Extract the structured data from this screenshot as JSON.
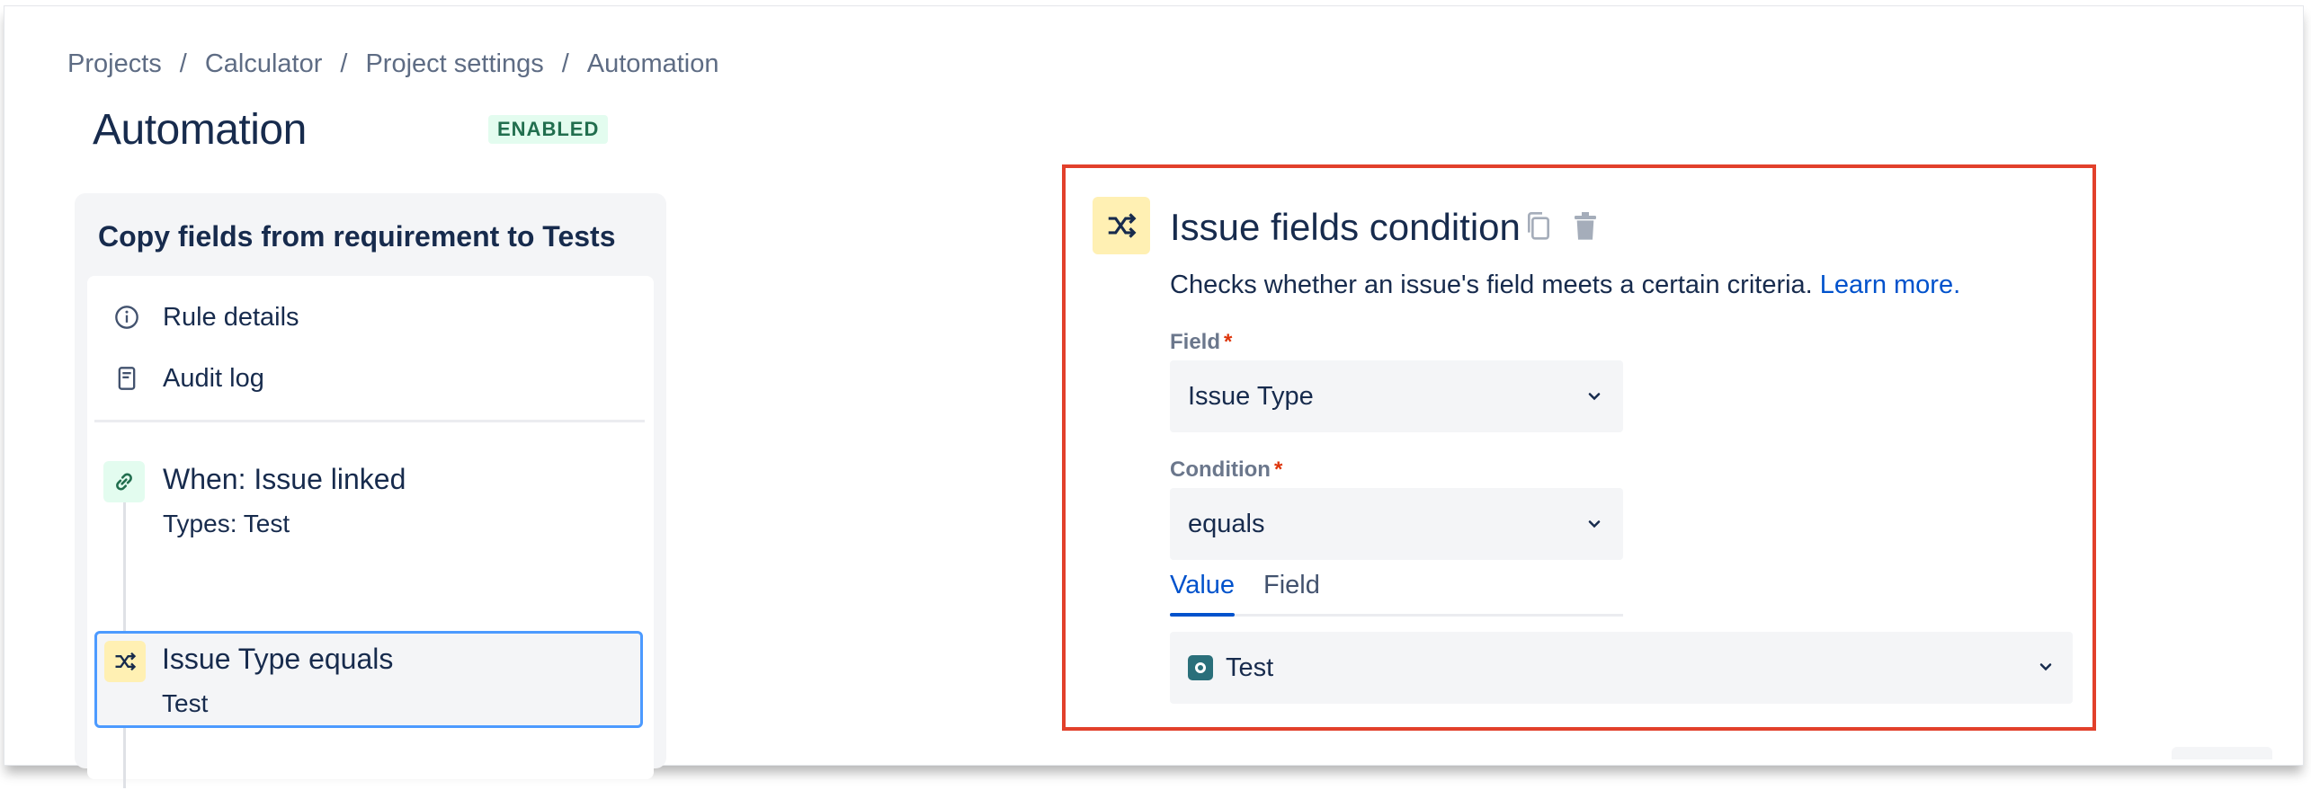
{
  "breadcrumb": {
    "items": [
      "Projects",
      "Calculator",
      "Project settings",
      "Automation"
    ],
    "separator": "/"
  },
  "page": {
    "title": "Automation",
    "status": "ENABLED"
  },
  "rule": {
    "name": "Copy fields from requirement to Tests",
    "menu": [
      {
        "label": "Rule details",
        "icon": "info-icon"
      },
      {
        "label": "Audit log",
        "icon": "document-icon"
      }
    ],
    "trigger": {
      "title": "When: Issue linked",
      "subtitle": "Types: Test",
      "icon": "link-icon"
    },
    "condition": {
      "title": "Issue Type equals",
      "subtitle": "Test",
      "icon": "shuffle-icon"
    }
  },
  "config": {
    "title": "Issue fields condition",
    "description": "Checks whether an issue's field meets a certain criteria.",
    "learn_more": "Learn more.",
    "field_label": "Field",
    "field_value": "Issue Type",
    "condition_label": "Condition",
    "condition_value": "equals",
    "tabs": [
      "Value",
      "Field"
    ],
    "value": "Test",
    "required_marker": "*"
  },
  "colors": {
    "accent": "#0052cc",
    "highlight_border": "#e2402b",
    "selected_border": "#4c9aff",
    "condition_bg": "#fff0b3",
    "trigger_bg": "#e3fcef",
    "enabled_text": "#216e4e"
  }
}
